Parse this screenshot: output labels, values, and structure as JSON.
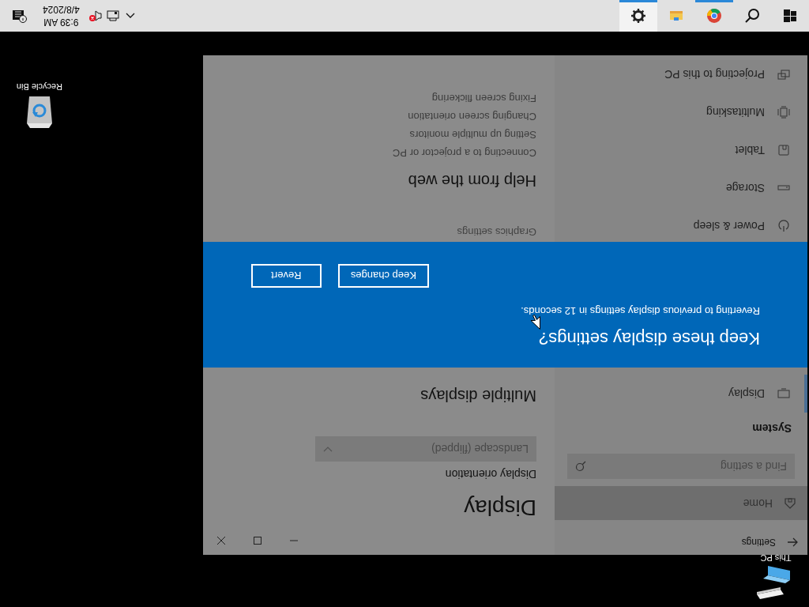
{
  "desktop_icons": [
    {
      "kind": "pc",
      "label": "This PC"
    },
    {
      "kind": "recycle",
      "label": "Recycle Bin"
    }
  ],
  "settings_window": {
    "title": "Settings",
    "home": {
      "label": "Home",
      "highlighted": true
    },
    "search": {
      "placeholder": "Find a setting"
    },
    "section": "System",
    "nav": [
      {
        "kind": "display",
        "label": "Display",
        "selected": true
      },
      {
        "kind": "power",
        "label": "Power & sleep",
        "selected": false
      },
      {
        "kind": "storage",
        "label": "Storage",
        "selected": false
      },
      {
        "kind": "tablet",
        "label": "Tablet",
        "selected": false
      },
      {
        "kind": "multitasking",
        "label": "Multitasking",
        "selected": false
      },
      {
        "kind": "projecting",
        "label": "Projecting to this PC",
        "selected": false
      }
    ],
    "content": {
      "heading": "Display",
      "orientation_label": "Display orientation",
      "orientation_value": "Landscape (flipped)",
      "multiple_displays": "Multiple displays",
      "graphics_settings": "Graphics settings",
      "help_heading": "Help from the web",
      "help_links": [
        "Connecting to a projector or PC",
        "Setting up multiple monitors",
        "Changing screen orientation",
        "Fixing screen flickering"
      ]
    }
  },
  "dialog": {
    "title": "Keep these display settings?",
    "message": "Reverting to previous display settings in 12 seconds.",
    "buttons": [
      "Keep changes",
      "Revert"
    ]
  },
  "taskbar": {
    "apps": [
      {
        "kind": "start",
        "running": false,
        "active": false
      },
      {
        "kind": "search",
        "running": false,
        "active": false
      },
      {
        "kind": "chrome",
        "running": true,
        "active": false
      },
      {
        "kind": "explorer",
        "running": false,
        "active": false
      },
      {
        "kind": "settings",
        "running": true,
        "active": true
      }
    ],
    "tray": {
      "volume_muted": true,
      "time": "9:39 AM",
      "date": "4/8/2024"
    }
  }
}
